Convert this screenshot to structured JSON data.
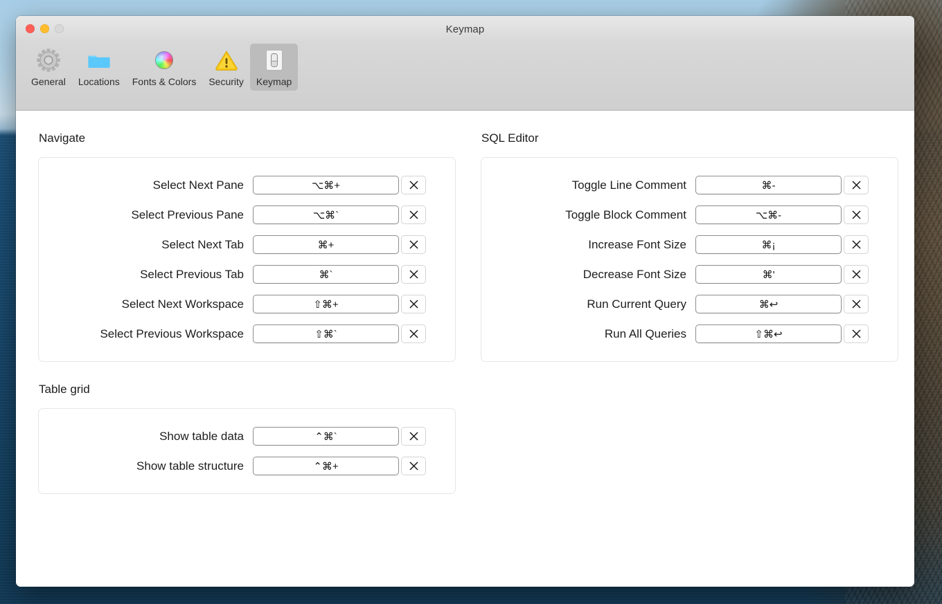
{
  "window": {
    "title": "Keymap",
    "traffic_lights": [
      {
        "name": "close",
        "color": "#ff5f57"
      },
      {
        "name": "minimize",
        "color": "#ffbd2e"
      },
      {
        "name": "zoom",
        "color": "#d8d8d8"
      }
    ]
  },
  "toolbar": {
    "items": [
      {
        "label": "General",
        "icon": "gear-icon",
        "selected": false
      },
      {
        "label": "Locations",
        "icon": "folder-icon",
        "selected": false
      },
      {
        "label": "Fonts & Colors",
        "icon": "color-wheel-icon",
        "selected": false
      },
      {
        "label": "Security",
        "icon": "warning-triangle-icon",
        "selected": false
      },
      {
        "label": "Keymap",
        "icon": "switch-icon",
        "selected": true
      }
    ]
  },
  "clear_button_label": "×",
  "sections": [
    {
      "id": "navigate",
      "title": "Navigate",
      "column": "left",
      "rows": [
        {
          "label": "Select Next Pane",
          "shortcut": "⌥⌘+"
        },
        {
          "label": "Select Previous Pane",
          "shortcut": "⌥⌘`"
        },
        {
          "label": "Select Next Tab",
          "shortcut": "⌘+"
        },
        {
          "label": "Select Previous Tab",
          "shortcut": "⌘`"
        },
        {
          "label": "Select Next Workspace",
          "shortcut": "⇧⌘+"
        },
        {
          "label": "Select Previous Workspace",
          "shortcut": "⇧⌘`"
        }
      ]
    },
    {
      "id": "sql-editor",
      "title": "SQL Editor",
      "column": "right",
      "rows": [
        {
          "label": "Toggle Line Comment",
          "shortcut": "⌘-"
        },
        {
          "label": "Toggle Block Comment",
          "shortcut": "⌥⌘-"
        },
        {
          "label": "Increase Font Size",
          "shortcut": "⌘¡"
        },
        {
          "label": "Decrease Font Size",
          "shortcut": "⌘'"
        },
        {
          "label": "Run Current Query",
          "shortcut": "⌘↩"
        },
        {
          "label": "Run All Queries",
          "shortcut": "⇧⌘↩"
        }
      ]
    },
    {
      "id": "table-grid",
      "title": "Table grid",
      "column": "left",
      "rows": [
        {
          "label": "Show table data",
          "shortcut": "⌃⌘`"
        },
        {
          "label": "Show table structure",
          "shortcut": "⌃⌘+"
        }
      ]
    }
  ]
}
